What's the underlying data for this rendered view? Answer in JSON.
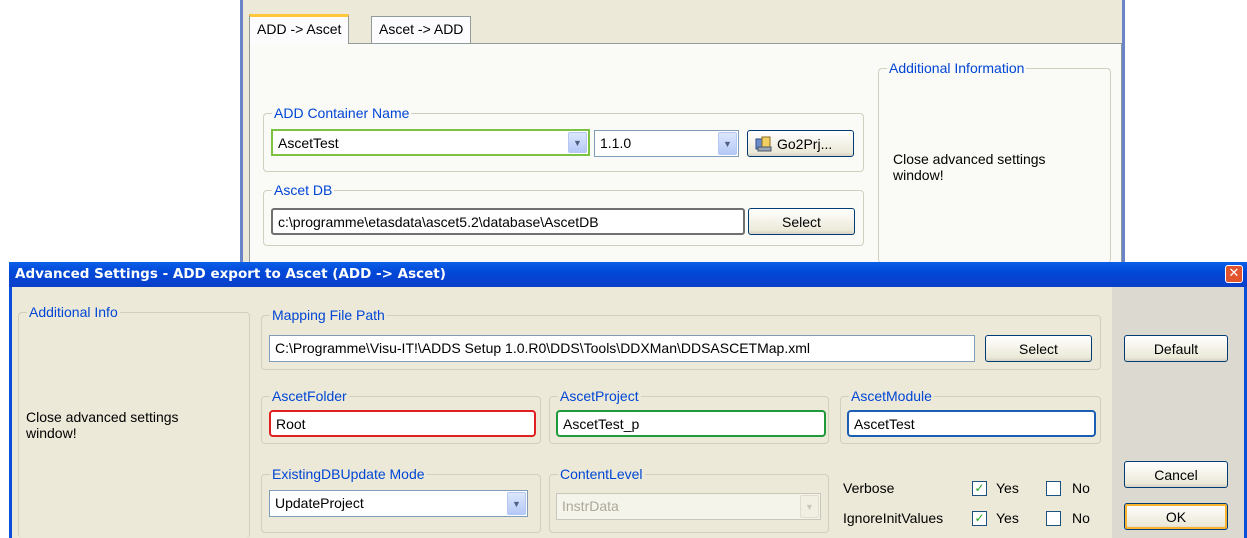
{
  "background_window": {
    "tabs": [
      "ADD -> Ascet",
      "Ascet -> ADD"
    ],
    "add_container": {
      "title": "ADD Container Name",
      "name_value": "AscetTest",
      "version_value": "1.1.0",
      "go_button": "Go2Prj..."
    },
    "ascet_db": {
      "title": "Ascet DB",
      "path": "c:\\programme\\etasdata\\ascet5.2\\database\\AscetDB",
      "select_button": "Select"
    },
    "additional_info": {
      "title": "Additional Information",
      "text": "Close advanced settings window!"
    }
  },
  "dialog": {
    "title": "Advanced Settings - ADD export to Ascet (ADD -> Ascet)",
    "additional_info": {
      "title": "Additional Info",
      "text": "Close advanced settings window!"
    },
    "mapping": {
      "title": "Mapping File Path",
      "path": "C:\\Programme\\Visu-IT!\\ADDS Setup 1.0.R0\\DDS\\Tools\\DDXMan\\DDSASCETMap.xml",
      "select_button": "Select"
    },
    "ascet_folder": {
      "title": "AscetFolder",
      "value": "Root",
      "border_color": "#e02020"
    },
    "ascet_project": {
      "title": "AscetProject",
      "value": "AscetTest_p",
      "border_color": "#1f9a3a"
    },
    "ascet_module": {
      "title": "AscetModule",
      "value": "AscetTest",
      "border_color": "#1a5fb4"
    },
    "update_mode": {
      "title": "ExistingDBUpdate Mode",
      "value": "UpdateProject"
    },
    "content_level": {
      "title": "ContentLevel",
      "value": "InstrData"
    },
    "options": [
      {
        "label": "Verbose",
        "yes_label": "Yes",
        "yes_checked": true,
        "no_label": "No",
        "no_checked": false
      },
      {
        "label": "IgnoreInitValues",
        "yes_label": "Yes",
        "yes_checked": true,
        "no_label": "No",
        "no_checked": false
      }
    ],
    "buttons": {
      "default": "Default",
      "cancel": "Cancel",
      "ok": "OK"
    }
  },
  "colors": {
    "title_bar": "#0a4fd9",
    "group_title": "#0046d5",
    "container_highlight": "#7cc242"
  }
}
